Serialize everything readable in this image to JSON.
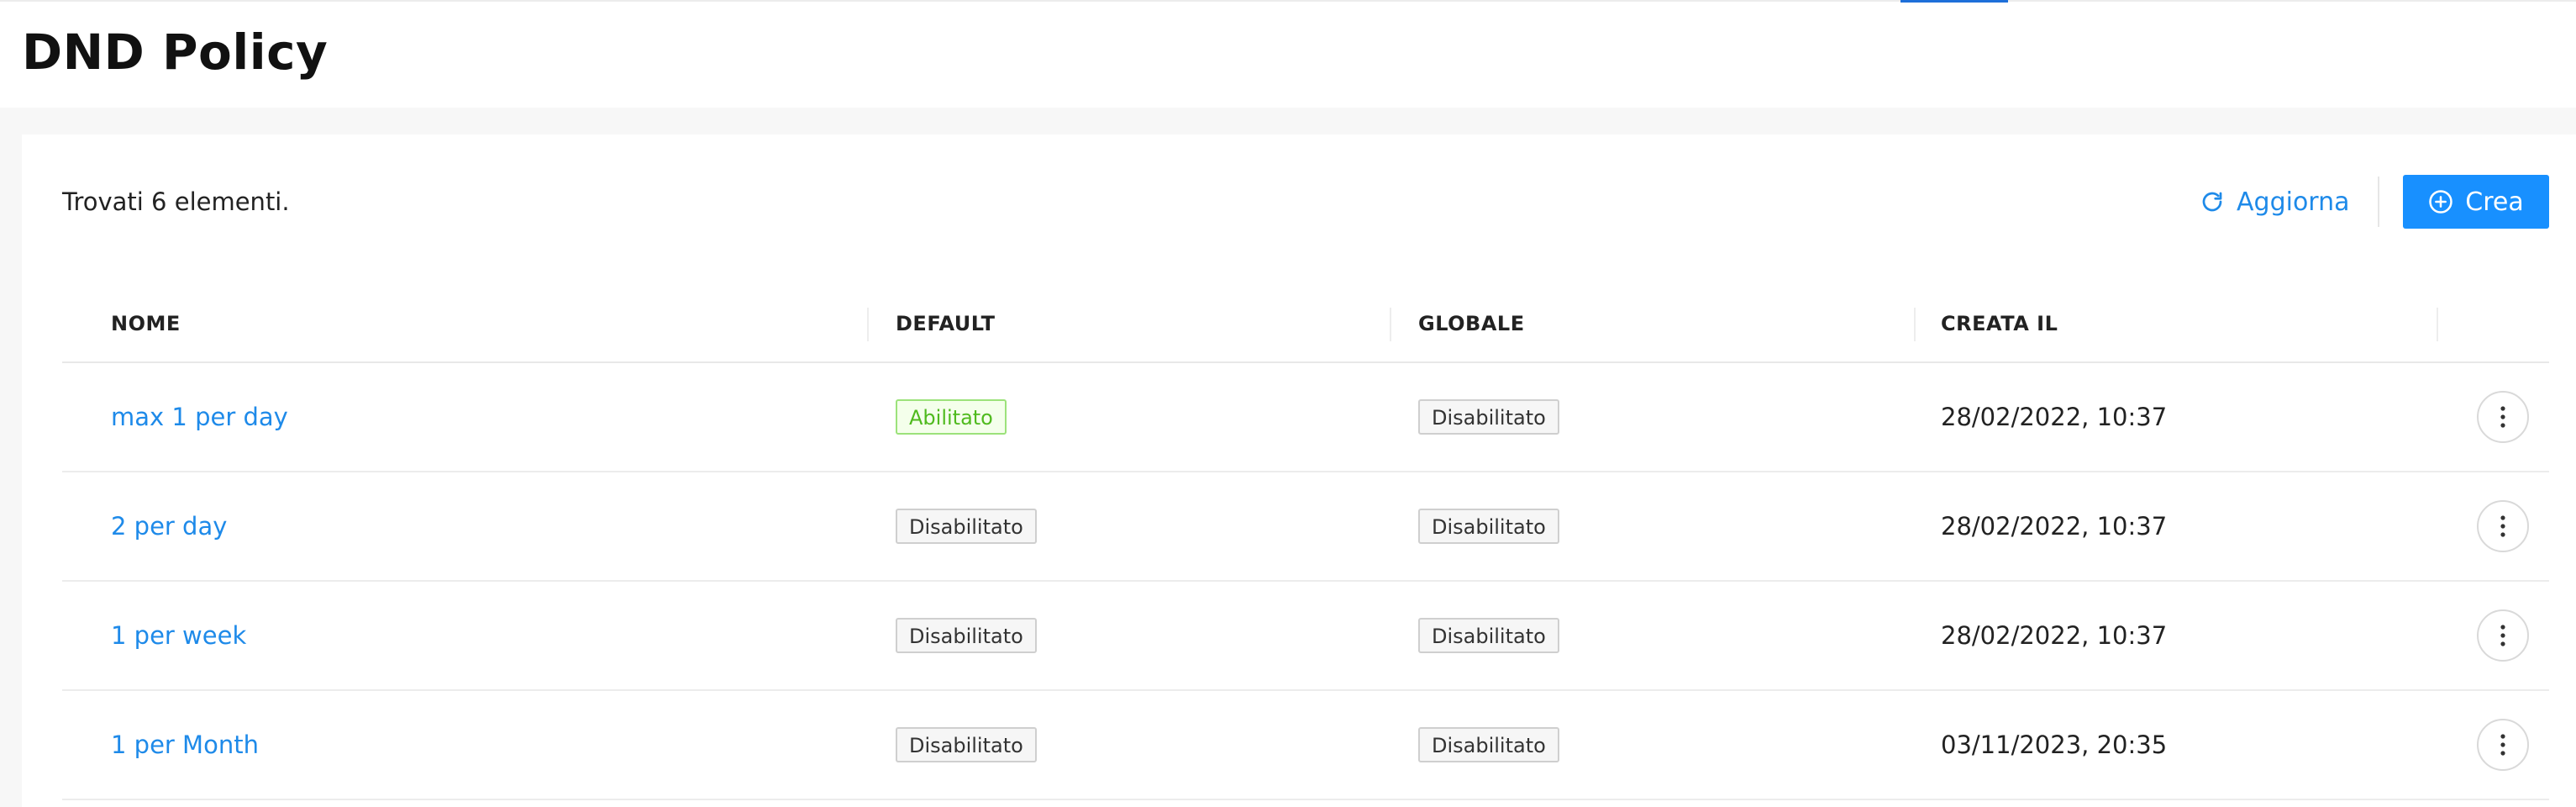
{
  "page": {
    "title": "DND Policy"
  },
  "toolbar": {
    "results_text": "Trovati 6 elementi.",
    "refresh_label": "Aggiorna",
    "refresh_icon": "refresh-icon",
    "create_label": "Crea",
    "create_icon": "plus-circle-icon"
  },
  "table": {
    "columns": [
      "NOME",
      "DEFAULT",
      "GLOBALE",
      "CREATA IL"
    ],
    "rows": [
      {
        "name": "max 1 per day",
        "default": "Abilitato",
        "default_enabled": true,
        "global": "Disabilitato",
        "global_enabled": false,
        "created": "28/02/2022, 10:37"
      },
      {
        "name": "2 per day",
        "default": "Disabilitato",
        "default_enabled": false,
        "global": "Disabilitato",
        "global_enabled": false,
        "created": "28/02/2022, 10:37"
      },
      {
        "name": "1 per week",
        "default": "Disabilitato",
        "default_enabled": false,
        "global": "Disabilitato",
        "global_enabled": false,
        "created": "28/02/2022, 10:37"
      },
      {
        "name": "1 per Month",
        "default": "Disabilitato",
        "default_enabled": false,
        "global": "Disabilitato",
        "global_enabled": false,
        "created": "03/11/2023, 20:35"
      }
    ],
    "row_action_icon": "more-vertical-icon"
  },
  "colors": {
    "primary": "#1890ff",
    "link": "#1e8ae9",
    "enabled_text": "#4fba1e",
    "enabled_border": "#9ce27b",
    "enabled_bg": "#f4ffeb",
    "disabled_border": "#cfcfcf",
    "disabled_bg": "#f6f6f6"
  }
}
